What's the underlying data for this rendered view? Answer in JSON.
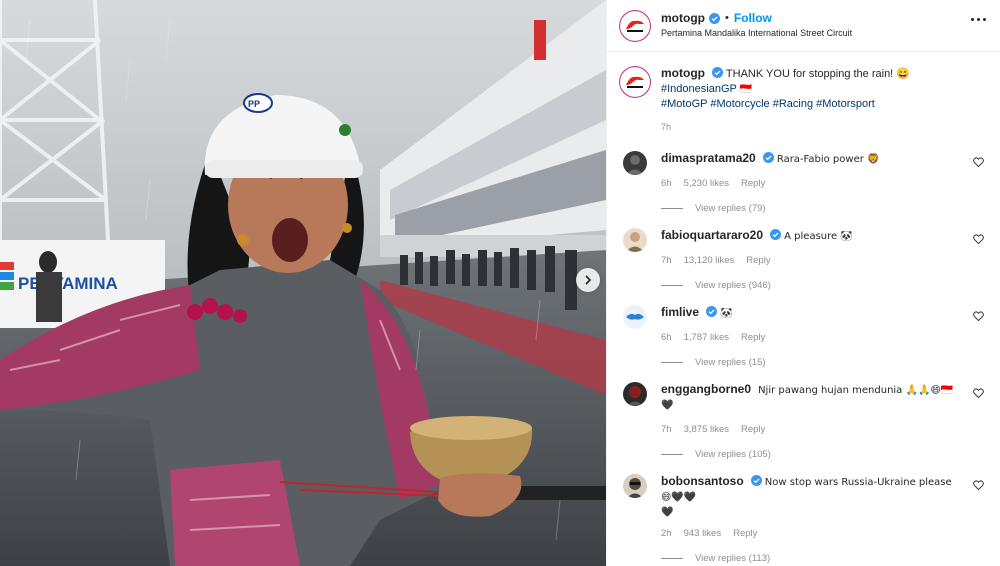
{
  "post": {
    "username": "motogp",
    "follow_label": "Follow",
    "separator": "•",
    "location": "Pertamina Mandalika International Street Circuit",
    "image_banner_text": "PERTAMINA",
    "helmet_badge": "PP"
  },
  "caption": {
    "username": "motogp",
    "text": "THANK YOU for stopping the rain! 😄",
    "hashtags_line1": "#IndonesianGP",
    "flag_glyph": "🇮🇩",
    "hashtags_line2": [
      "#MotoGP",
      "#Motorcycle",
      "#Racing",
      "#Motorsport"
    ],
    "time": "7h"
  },
  "comments": [
    {
      "username": "dimaspratama20",
      "verified": true,
      "text": "Rara-Fabio power 🦁",
      "time": "6h",
      "likes": "5,230 likes",
      "reply": "Reply",
      "view_replies": "View replies (79)",
      "avatar_color": "#3a3a3a"
    },
    {
      "username": "fabioquartararo20",
      "verified": true,
      "text": "A pleasure 🐼",
      "time": "7h",
      "likes": "13,120 likes",
      "reply": "Reply",
      "view_replies": "View replies (946)",
      "avatar_color": "#c9a37a"
    },
    {
      "username": "fimlive",
      "verified": true,
      "text": "🐼",
      "time": "6h",
      "likes": "1,787 likes",
      "reply": "Reply",
      "view_replies": "View replies (15)",
      "avatar_color": "#2f7fd0"
    },
    {
      "username": "enggangborne0",
      "verified": false,
      "text": "Njir pawang hujan mendunia 🙏🙏😄🇮🇩🖤",
      "time": "7h",
      "likes": "3,875 likes",
      "reply": "Reply",
      "view_replies": "View replies (105)",
      "avatar_color": "#8b1f1f"
    },
    {
      "username": "bobonsantoso",
      "verified": true,
      "text": "Now stop wars Russia-Ukraine please 😄🖤🖤",
      "text_line2": "🖤",
      "time": "2h",
      "likes": "943 likes",
      "reply": "Reply",
      "view_replies": "View replies (113)",
      "avatar_color": "#5a4a3a"
    }
  ],
  "colors": {
    "accent": "#0095f6",
    "hashtag": "#00376b",
    "verified": "#3897f0",
    "muted": "#8e8e8e"
  }
}
